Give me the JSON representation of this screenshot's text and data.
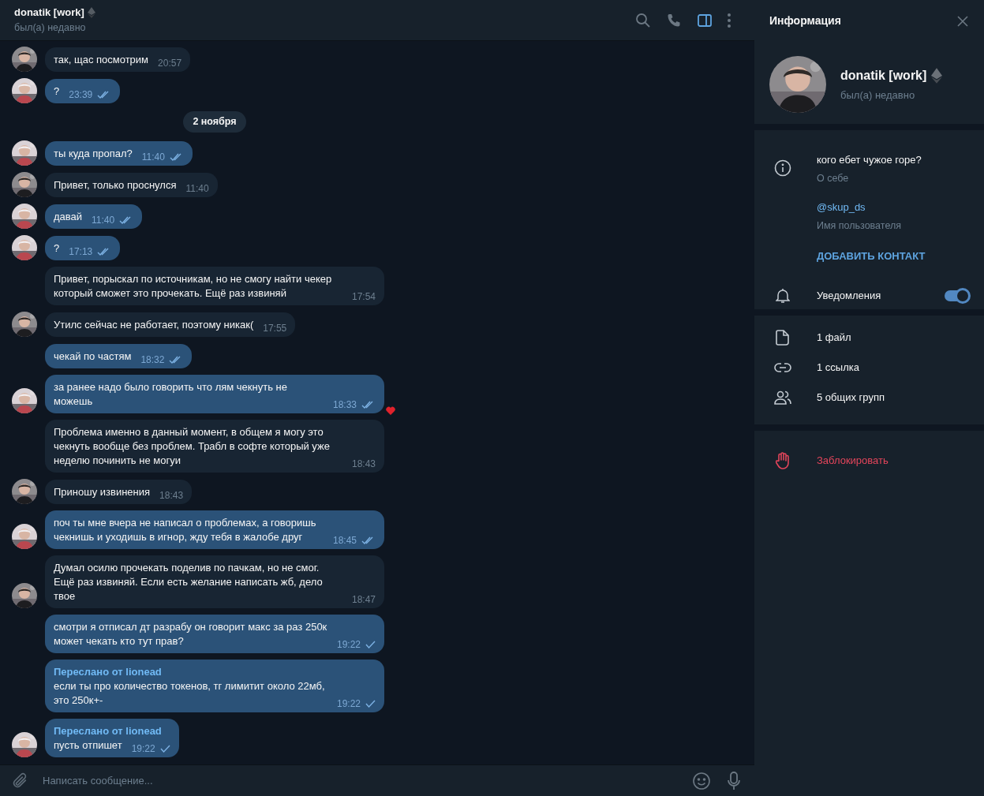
{
  "chat_header": {
    "title": "donatik [work]",
    "status": "был(а) недавно",
    "info_panel_open": true
  },
  "messages": [
    {
      "kind": "message",
      "outgoing": false,
      "text": "так, щас посмотрим",
      "time": "20:57",
      "avatar": true
    },
    {
      "kind": "message",
      "outgoing": true,
      "text": "?",
      "time": "23:39",
      "read": true,
      "avatar": true
    },
    {
      "kind": "date",
      "text": "2 ноября"
    },
    {
      "kind": "message",
      "outgoing": true,
      "text": "ты куда пропал?",
      "time": "11:40",
      "read": true,
      "avatar": true
    },
    {
      "kind": "message",
      "outgoing": false,
      "text": "Привет, только проснулся",
      "time": "11:40",
      "avatar": true
    },
    {
      "kind": "message",
      "outgoing": true,
      "text": "давай",
      "time": "11:40",
      "read": true,
      "avatar": true
    },
    {
      "kind": "message",
      "outgoing": true,
      "text": "?",
      "time": "17:13",
      "read": true,
      "avatar": true
    },
    {
      "kind": "message",
      "outgoing": false,
      "text": "Привет, порыскал по источникам, но не смогу найти чекер который сможет это прочекать. Ещё раз извиняй",
      "time": "17:54",
      "avatar": false
    },
    {
      "kind": "message",
      "outgoing": false,
      "text": "Утилс сейчас не работает, поэтому никак(",
      "time": "17:55",
      "avatar": true
    },
    {
      "kind": "message",
      "outgoing": true,
      "text": "чекай по частям",
      "time": "18:32",
      "read": true,
      "avatar": false
    },
    {
      "kind": "message",
      "outgoing": true,
      "text": "за ранее надо было говорить что лям чекнуть не можешь",
      "time": "18:33",
      "read": true,
      "avatar": true,
      "reacted": true
    },
    {
      "kind": "message",
      "outgoing": false,
      "text": "Проблема именно в данный момент, в общем я могу это чекнуть вообще без проблем. Трабл в софте который уже неделю починить не могуи",
      "time": "18:43",
      "avatar": false
    },
    {
      "kind": "message",
      "outgoing": false,
      "text": "Приношу извинения",
      "time": "18:43",
      "avatar": true
    },
    {
      "kind": "message",
      "outgoing": true,
      "text": "поч ты мне вчера не написал о проблемах, а говоришь чекнишь и уходишь в игнор, жду тебя в жалобе друг",
      "time": "18:45",
      "read": true,
      "avatar": true
    },
    {
      "kind": "message",
      "outgoing": false,
      "text": "Думал осилю прочекать поделив по пачкам, но не смог. Ещё раз извиняй. Если есть желание написать жб, дело твое",
      "time": "18:47",
      "avatar": true
    },
    {
      "kind": "message",
      "outgoing": true,
      "text": "смотри я отписал дт разрабу он говорит макс за раз 250к может чекать кто тут прав?",
      "time": "19:22",
      "read": false,
      "avatar": false
    },
    {
      "kind": "message",
      "outgoing": true,
      "forward_header": "Переслано от lionead",
      "text": "если ты про количество токенов, тг лимитит около 22мб, это 250к+-",
      "time": "19:22",
      "read": false,
      "avatar": false
    },
    {
      "kind": "message",
      "outgoing": true,
      "forward_header": "Переслано от lionead",
      "text": "пусть отпишет",
      "time": "19:22",
      "read": false,
      "avatar": true
    }
  ],
  "composer": {
    "placeholder": "Написать сообщение..."
  },
  "info_panel": {
    "title": "Информация",
    "name": "donatik [work]",
    "status": "был(а) недавно",
    "bio": "кого ебет чужое горе?",
    "bio_label": "О себе",
    "username": "@skup_ds",
    "username_label": "Имя пользователя",
    "add_contact": "ДОБАВИТЬ КОНТАКТ",
    "notifications": {
      "label": "Уведомления",
      "on": true
    },
    "media": [
      {
        "kind": "file",
        "label": "1 файл"
      },
      {
        "kind": "link",
        "label": "1 ссылка"
      },
      {
        "kind": "groups",
        "label": "5 общих групп"
      }
    ],
    "block": "Заблокировать"
  }
}
